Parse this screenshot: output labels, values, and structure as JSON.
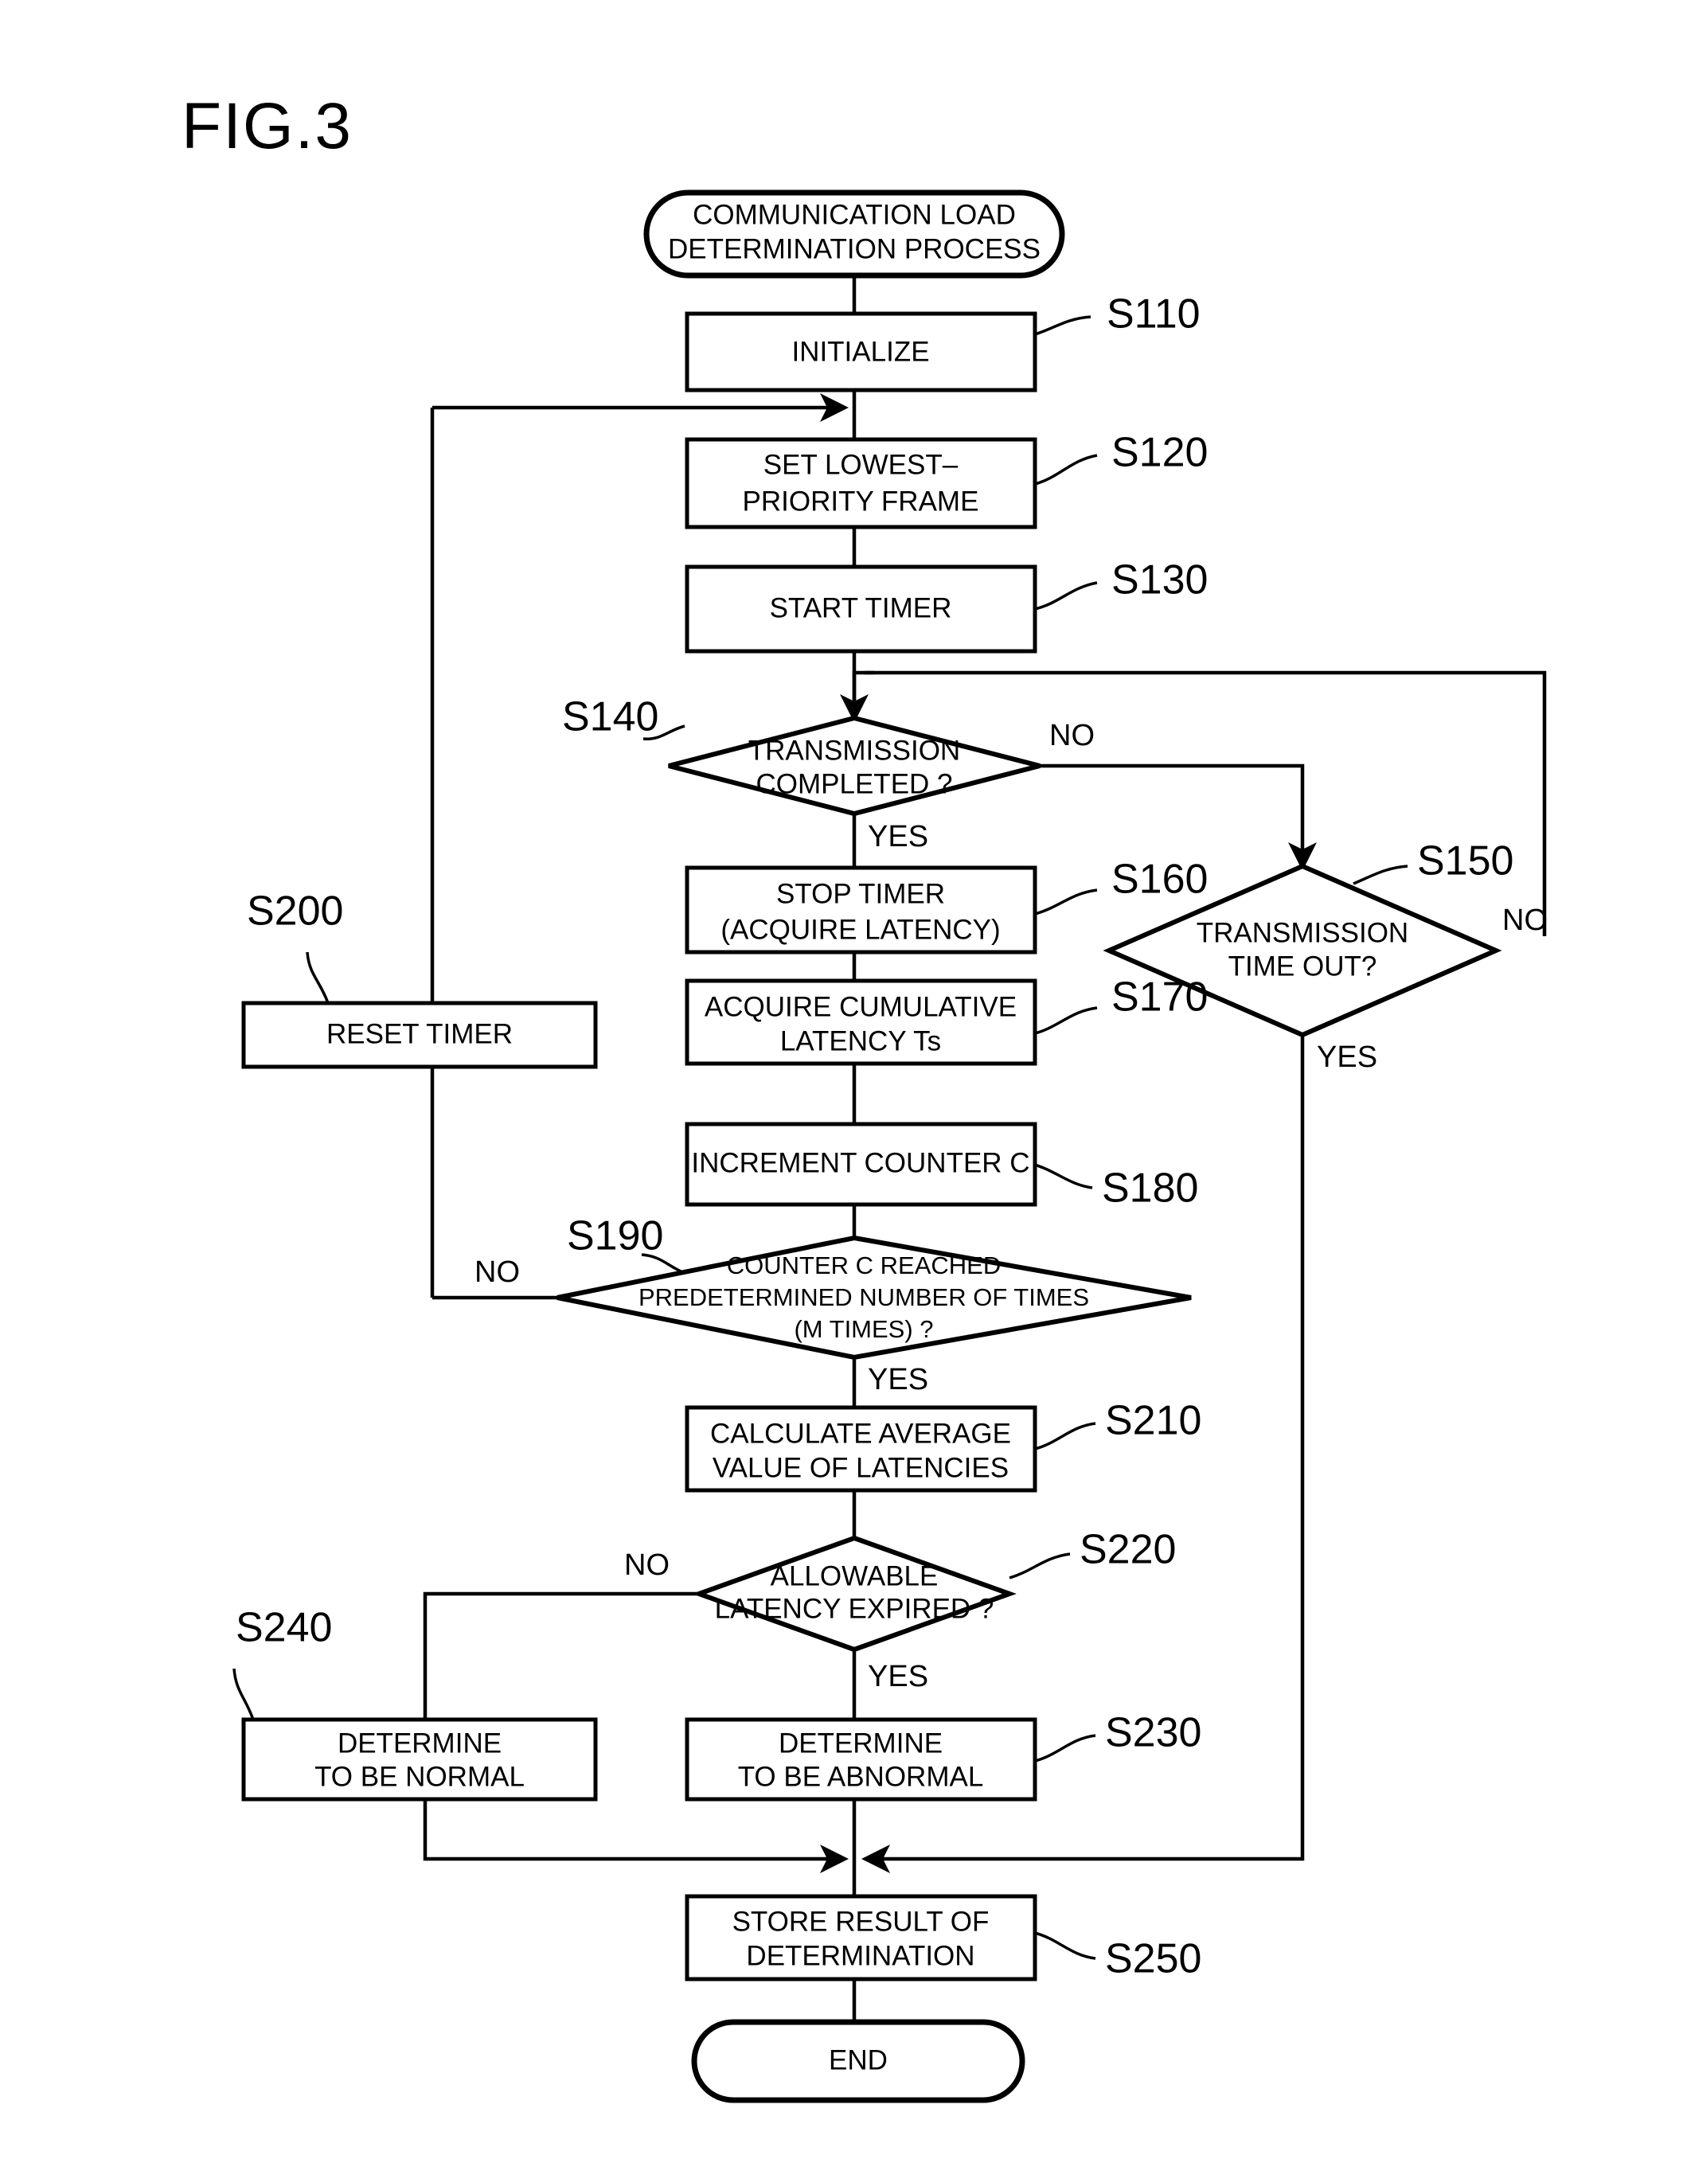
{
  "figure": {
    "title": "FIG.3",
    "type": "flowchart"
  },
  "nodes": {
    "start": {
      "ref": "",
      "shape": "terminator",
      "line1": "COMMUNICATION LOAD",
      "line2": "DETERMINATION PROCESS"
    },
    "s110": {
      "ref": "S110",
      "shape": "process",
      "line1": "INITIALIZE",
      "line2": ""
    },
    "s120": {
      "ref": "S120",
      "shape": "process",
      "line1": "SET LOWEST–",
      "line2": "PRIORITY FRAME"
    },
    "s130": {
      "ref": "S130",
      "shape": "process",
      "line1": "START TIMER",
      "line2": ""
    },
    "s140": {
      "ref": "S140",
      "shape": "decision",
      "line1": "TRANSMISSION",
      "line2": "COMPLETED ?"
    },
    "s150": {
      "ref": "S150",
      "shape": "decision",
      "line1": "TRANSMISSION",
      "line2": "TIME OUT?"
    },
    "s160": {
      "ref": "S160",
      "shape": "process",
      "line1": "STOP TIMER",
      "line2": "(ACQUIRE LATENCY)"
    },
    "s170": {
      "ref": "S170",
      "shape": "process",
      "line1": "ACQUIRE CUMULATIVE",
      "line2": "LATENCY Ts"
    },
    "s180": {
      "ref": "S180",
      "shape": "process",
      "line1": "INCREMENT COUNTER C",
      "line2": ""
    },
    "s190": {
      "ref": "S190",
      "shape": "decision",
      "line1": "COUNTER C REACHED",
      "line2": "PREDETERMINED NUMBER OF TIMES",
      "line3": "(M TIMES) ?"
    },
    "s200": {
      "ref": "S200",
      "shape": "process",
      "line1": "RESET TIMER",
      "line2": ""
    },
    "s210": {
      "ref": "S210",
      "shape": "process",
      "line1": "CALCULATE AVERAGE",
      "line2": "VALUE OF LATENCIES"
    },
    "s220": {
      "ref": "S220",
      "shape": "decision",
      "line1": "ALLOWABLE",
      "line2": "LATENCY EXPIRED ?"
    },
    "s230": {
      "ref": "S230",
      "shape": "process",
      "line1": "DETERMINE",
      "line2": "TO BE ABNORMAL"
    },
    "s240": {
      "ref": "S240",
      "shape": "process",
      "line1": "DETERMINE",
      "line2": "TO BE NORMAL"
    },
    "s250": {
      "ref": "S250",
      "shape": "process",
      "line1": "STORE RESULT OF",
      "line2": "DETERMINATION"
    },
    "end": {
      "ref": "",
      "shape": "terminator",
      "line1": "END",
      "line2": ""
    }
  },
  "branch_labels": {
    "s140_no": "NO",
    "s140_yes": "YES",
    "s150_no": "NO",
    "s150_yes": "YES",
    "s190_no": "NO",
    "s190_yes": "YES",
    "s220_no": "NO",
    "s220_yes": "YES"
  },
  "colors": {
    "ink": "#000000",
    "paper": "#ffffff"
  }
}
